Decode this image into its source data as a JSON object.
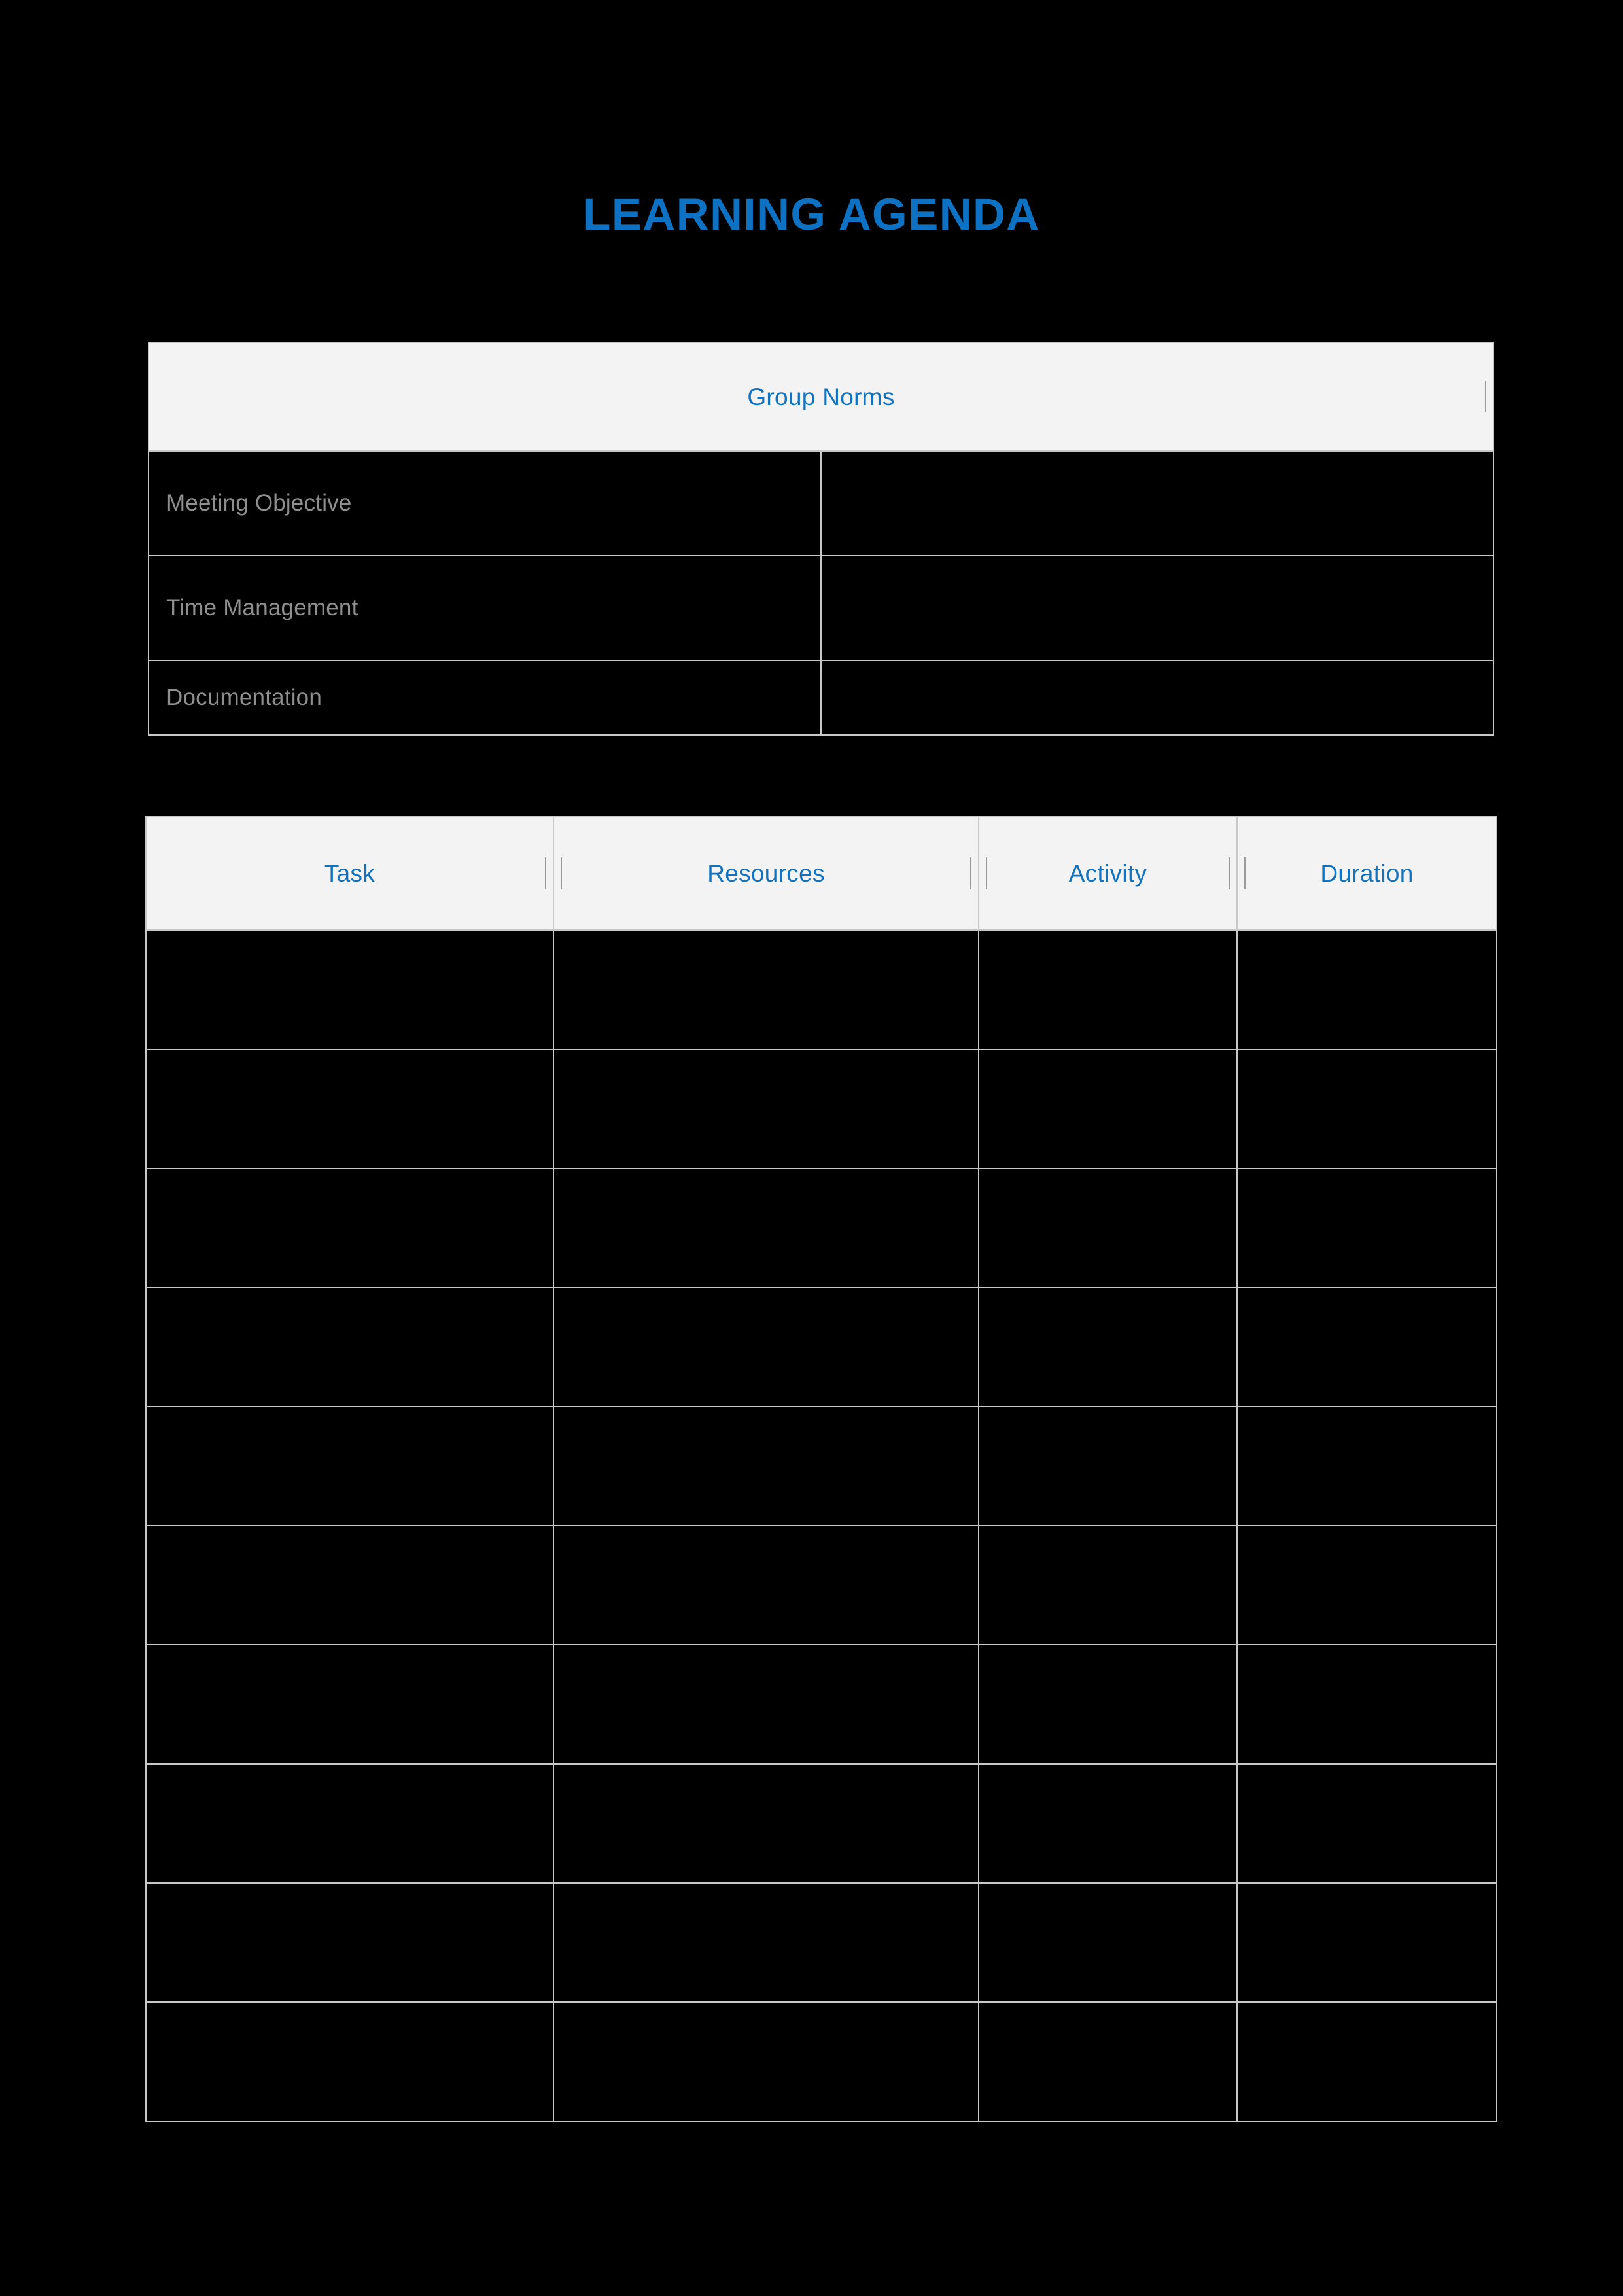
{
  "document": {
    "title": "LEARNING AGENDA",
    "accent_color": "#0d72c4",
    "header_fill": "#f3f3f3",
    "border_color": "#c8c8c8",
    "page_background": "#000000",
    "label_color": "#8f8f8f"
  },
  "group_norms_table": {
    "header": "Group Norms",
    "rows": [
      {
        "label": "Meeting Objective",
        "value": ""
      },
      {
        "label": "Time Management",
        "value": ""
      },
      {
        "label": "Documentation",
        "value": ""
      }
    ]
  },
  "agenda_table": {
    "columns": [
      {
        "key": "task",
        "label": "Task"
      },
      {
        "key": "resources",
        "label": "Resources"
      },
      {
        "key": "activity",
        "label": "Activity"
      },
      {
        "key": "duration",
        "label": "Duration"
      }
    ],
    "row_count": 10,
    "rows": [
      {
        "task": "",
        "resources": "",
        "activity": "",
        "duration": ""
      },
      {
        "task": "",
        "resources": "",
        "activity": "",
        "duration": ""
      },
      {
        "task": "",
        "resources": "",
        "activity": "",
        "duration": ""
      },
      {
        "task": "",
        "resources": "",
        "activity": "",
        "duration": ""
      },
      {
        "task": "",
        "resources": "",
        "activity": "",
        "duration": ""
      },
      {
        "task": "",
        "resources": "",
        "activity": "",
        "duration": ""
      },
      {
        "task": "",
        "resources": "",
        "activity": "",
        "duration": ""
      },
      {
        "task": "",
        "resources": "",
        "activity": "",
        "duration": ""
      },
      {
        "task": "",
        "resources": "",
        "activity": "",
        "duration": ""
      },
      {
        "task": "",
        "resources": "",
        "activity": "",
        "duration": ""
      }
    ]
  }
}
